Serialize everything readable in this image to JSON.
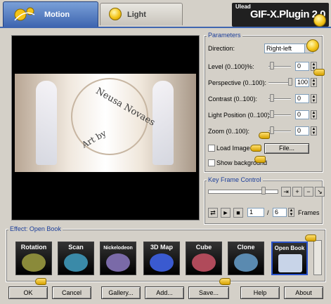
{
  "tabs": {
    "motion": "Motion",
    "light": "Light"
  },
  "brand": {
    "small": "Ulead",
    "main": "GIF-X.Plugin 2.0"
  },
  "preview": {
    "watermark_top": "Neusa Novaes",
    "watermark_bottom": "Art by"
  },
  "parameters": {
    "title": "Parameters",
    "direction_label": "Direction:",
    "direction_value": "Right-left",
    "rows": [
      {
        "label": "Level (0..100)%:",
        "value": "0"
      },
      {
        "label": "Perspective (0..100):",
        "value": "100"
      },
      {
        "label": "Contrast (0..100):",
        "value": "0"
      },
      {
        "label": "Light Position (0..100):",
        "value": "0"
      },
      {
        "label": "Zoom (0..100):",
        "value": "0"
      }
    ],
    "load_image_label": "Load Image",
    "file_button": "File...",
    "show_background_label": "Show background"
  },
  "keyframe": {
    "title": "Key Frame Control",
    "current_frame": "1",
    "separator": "/",
    "total_frames": "6",
    "frames_label": "Frames"
  },
  "effect": {
    "title": "Effect: Open Book",
    "items": [
      {
        "label": "Rotation",
        "color": "#8a8a3a"
      },
      {
        "label": "Scan",
        "color": "#3a8aa8"
      },
      {
        "label": "Nickelodeon",
        "color": "#7a6aa8"
      },
      {
        "label": "3D Map",
        "color": "#3a5ad0"
      },
      {
        "label": "Cube",
        "color": "#b04a5a"
      },
      {
        "label": "Clone",
        "color": "#5a8ab0"
      },
      {
        "label": "Open Book",
        "color": "#c8d4e8"
      }
    ]
  },
  "buttons": {
    "ok": "OK",
    "cancel": "Cancel",
    "gallery": "Gallery...",
    "add": "Add...",
    "save": "Save...",
    "help": "Help",
    "about": "About"
  }
}
